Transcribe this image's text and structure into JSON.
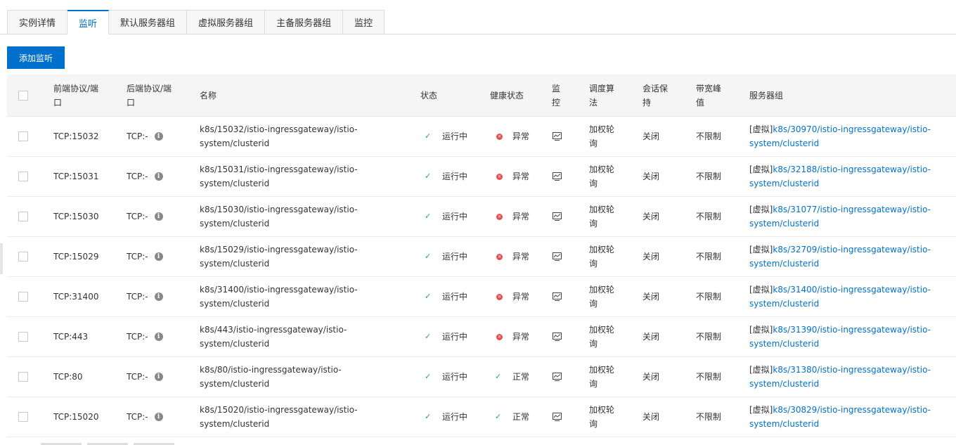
{
  "tabs": [
    {
      "label": "实例详情"
    },
    {
      "label": "监听"
    },
    {
      "label": "默认服务器组"
    },
    {
      "label": "虚拟服务器组"
    },
    {
      "label": "主备服务器组"
    },
    {
      "label": "监控"
    }
  ],
  "active_tab": "监听",
  "toolbar": {
    "add_label": "添加监听"
  },
  "columns": {
    "frontend": "前端协议/端口",
    "backend": "后端协议/端口",
    "name": "名称",
    "status": "状态",
    "health": "健康状态",
    "monitor": "监控",
    "algorithm": "调度算法",
    "session": "会话保持",
    "bandwidth": "带宽峰值",
    "server_group": "服务器组"
  },
  "header_wrapped": {
    "frontend": [
      "前端协议/端",
      "口"
    ],
    "backend": [
      "后端协议/端",
      "口"
    ],
    "monitor": [
      "监",
      "控"
    ],
    "algorithm": [
      "调度算",
      "法"
    ],
    "session": [
      "会话保",
      "持"
    ],
    "bandwidth": [
      "带宽峰",
      "值"
    ]
  },
  "rows": [
    {
      "frontend": "TCP:15032",
      "backend": "TCP:-",
      "name": [
        "k8s/15032/istio-ingressgateway/istio-",
        "system/clusterid"
      ],
      "status": "运行中",
      "health": "异常",
      "health_ok": false,
      "algorithm": [
        "加权轮",
        "询"
      ],
      "session": "关闭",
      "bandwidth": "不限制",
      "group_prefix": "[虚拟]",
      "group": [
        "k8s/30970/istio-ingressgateway/istio-",
        "system/clusterid"
      ]
    },
    {
      "frontend": "TCP:15031",
      "backend": "TCP:-",
      "name": [
        "k8s/15031/istio-ingressgateway/istio-",
        "system/clusterid"
      ],
      "status": "运行中",
      "health": "异常",
      "health_ok": false,
      "algorithm": [
        "加权轮",
        "询"
      ],
      "session": "关闭",
      "bandwidth": "不限制",
      "group_prefix": "[虚拟]",
      "group": [
        "k8s/32188/istio-ingressgateway/istio-",
        "system/clusterid"
      ]
    },
    {
      "frontend": "TCP:15030",
      "backend": "TCP:-",
      "name": [
        "k8s/15030/istio-ingressgateway/istio-",
        "system/clusterid"
      ],
      "status": "运行中",
      "health": "异常",
      "health_ok": false,
      "algorithm": [
        "加权轮",
        "询"
      ],
      "session": "关闭",
      "bandwidth": "不限制",
      "group_prefix": "[虚拟]",
      "group": [
        "k8s/31077/istio-ingressgateway/istio-",
        "system/clusterid"
      ]
    },
    {
      "frontend": "TCP:15029",
      "backend": "TCP:-",
      "name": [
        "k8s/15029/istio-ingressgateway/istio-",
        "system/clusterid"
      ],
      "status": "运行中",
      "health": "异常",
      "health_ok": false,
      "algorithm": [
        "加权轮",
        "询"
      ],
      "session": "关闭",
      "bandwidth": "不限制",
      "group_prefix": "[虚拟]",
      "group": [
        "k8s/32709/istio-ingressgateway/istio-",
        "system/clusterid"
      ]
    },
    {
      "frontend": "TCP:31400",
      "backend": "TCP:-",
      "name": [
        "k8s/31400/istio-ingressgateway/istio-",
        "system/clusterid"
      ],
      "status": "运行中",
      "health": "异常",
      "health_ok": false,
      "algorithm": [
        "加权轮",
        "询"
      ],
      "session": "关闭",
      "bandwidth": "不限制",
      "group_prefix": "[虚拟]",
      "group": [
        "k8s/31400/istio-ingressgateway/istio-",
        "system/clusterid"
      ]
    },
    {
      "frontend": "TCP:443",
      "backend": "TCP:-",
      "name": [
        "k8s/443/istio-ingressgateway/istio-system/clusterid"
      ],
      "status": "运行中",
      "health": "异常",
      "health_ok": false,
      "algorithm": [
        "加权轮",
        "询"
      ],
      "session": "关闭",
      "bandwidth": "不限制",
      "group_prefix": "[虚拟]",
      "group": [
        "k8s/31390/istio-ingressgateway/istio-",
        "system/clusterid"
      ]
    },
    {
      "frontend": "TCP:80",
      "backend": "TCP:-",
      "name": [
        "k8s/80/istio-ingressgateway/istio-system/clusterid"
      ],
      "status": "运行中",
      "health": "正常",
      "health_ok": true,
      "algorithm": [
        "加权轮",
        "询"
      ],
      "session": "关闭",
      "bandwidth": "不限制",
      "group_prefix": "[虚拟]",
      "group": [
        "k8s/31380/istio-ingressgateway/istio-",
        "system/clusterid"
      ]
    },
    {
      "frontend": "TCP:15020",
      "backend": "TCP:-",
      "name": [
        "k8s/15020/istio-ingressgateway/istio-",
        "system/clusterid"
      ],
      "status": "运行中",
      "health": "正常",
      "health_ok": true,
      "algorithm": [
        "加权轮",
        "询"
      ],
      "session": "关闭",
      "bandwidth": "不限制",
      "group_prefix": "[虚拟]",
      "group": [
        "k8s/30829/istio-ingressgateway/istio-",
        "system/clusterid"
      ]
    }
  ],
  "colors": {
    "accent": "#0070cc",
    "ok": "#2aa84a",
    "error": "#e84d4d"
  },
  "icons": {
    "status_ok": "check-icon",
    "health_error": "error-circle-icon",
    "health_ok": "check-icon",
    "backend_info": "info-icon",
    "monitor": "monitor-chart-icon"
  }
}
